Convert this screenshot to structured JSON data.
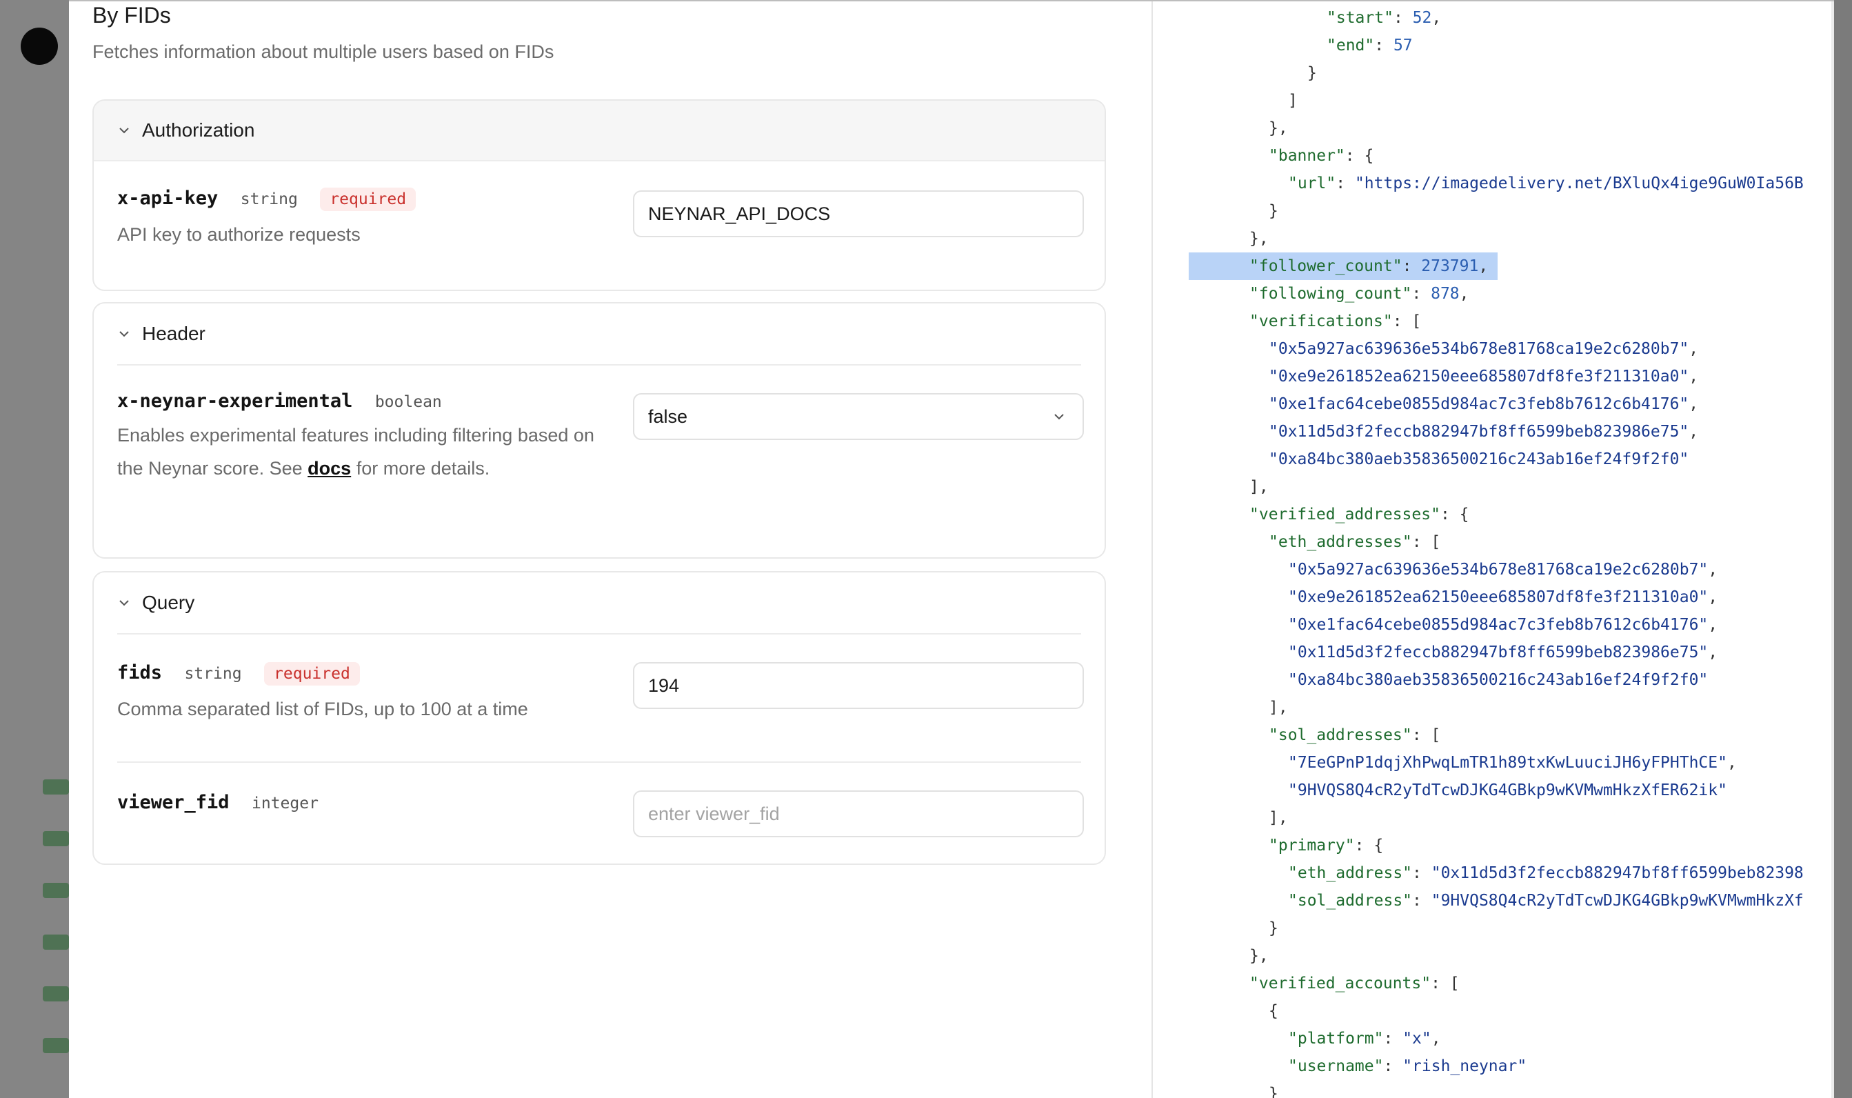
{
  "modal": {
    "title": "By FIDs",
    "description": "Fetches information about multiple users based on FIDs"
  },
  "authorization": {
    "section_title": "Authorization",
    "param": {
      "name": "x-api-key",
      "type": "string",
      "required_label": "required",
      "description": "API key to authorize requests",
      "value": "NEYNAR_API_DOCS"
    }
  },
  "header": {
    "section_title": "Header",
    "param": {
      "name": "x-neynar-experimental",
      "type": "boolean",
      "description_before": "Enables experimental features including filtering based on the Neynar score. See ",
      "link_text": "docs",
      "description_after": " for more details.",
      "value": "false"
    }
  },
  "query": {
    "section_title": "Query",
    "fids": {
      "name": "fids",
      "type": "string",
      "required_label": "required",
      "description": "Comma separated list of FIDs, up to 100 at a time",
      "value": "194"
    },
    "viewer_fid": {
      "name": "viewer_fid",
      "type": "integer",
      "placeholder": "enter viewer_fid"
    }
  },
  "colors": {
    "json_key": "#1e6b2e",
    "json_string": "#1a3a8f",
    "json_number": "#2a5db0",
    "highlight": "#b9d3f7",
    "required_badge": "#c9302c"
  },
  "response_json_lines": [
    {
      "indent": 8,
      "parts": [
        [
          "k",
          "\"start\""
        ],
        [
          "p",
          ": "
        ],
        [
          "n",
          "52"
        ],
        [
          "p",
          ","
        ]
      ]
    },
    {
      "indent": 8,
      "parts": [
        [
          "k",
          "\"end\""
        ],
        [
          "p",
          ": "
        ],
        [
          "n",
          "57"
        ]
      ]
    },
    {
      "indent": 7,
      "parts": [
        [
          "p",
          "}"
        ]
      ]
    },
    {
      "indent": 6,
      "parts": [
        [
          "p",
          "]"
        ]
      ]
    },
    {
      "indent": 5,
      "parts": [
        [
          "p",
          "},"
        ]
      ]
    },
    {
      "indent": 5,
      "parts": [
        [
          "k",
          "\"banner\""
        ],
        [
          "p",
          ": {"
        ]
      ]
    },
    {
      "indent": 6,
      "parts": [
        [
          "k",
          "\"url\""
        ],
        [
          "p",
          ": "
        ],
        [
          "s",
          "\"https://imagedelivery.net/BXluQx4ige9GuW0Ia56B"
        ]
      ]
    },
    {
      "indent": 5,
      "parts": [
        [
          "p",
          "}"
        ]
      ]
    },
    {
      "indent": 4,
      "parts": [
        [
          "p",
          "},"
        ]
      ]
    },
    {
      "indent": 4,
      "highlight": true,
      "parts": [
        [
          "k",
          "\"follower_count\""
        ],
        [
          "p",
          ": "
        ],
        [
          "n",
          "273791"
        ],
        [
          "p",
          ","
        ]
      ]
    },
    {
      "indent": 4,
      "parts": [
        [
          "k",
          "\"following_count\""
        ],
        [
          "p",
          ": "
        ],
        [
          "n",
          "878"
        ],
        [
          "p",
          ","
        ]
      ]
    },
    {
      "indent": 4,
      "parts": [
        [
          "k",
          "\"verifications\""
        ],
        [
          "p",
          ": ["
        ]
      ]
    },
    {
      "indent": 5,
      "parts": [
        [
          "s",
          "\"0x5a927ac639636e534b678e81768ca19e2c6280b7\""
        ],
        [
          "p",
          ","
        ]
      ]
    },
    {
      "indent": 5,
      "parts": [
        [
          "s",
          "\"0xe9e261852ea62150eee685807df8fe3f211310a0\""
        ],
        [
          "p",
          ","
        ]
      ]
    },
    {
      "indent": 5,
      "parts": [
        [
          "s",
          "\"0xe1fac64cebe0855d984ac7c3feb8b7612c6b4176\""
        ],
        [
          "p",
          ","
        ]
      ]
    },
    {
      "indent": 5,
      "parts": [
        [
          "s",
          "\"0x11d5d3f2feccb882947bf8ff6599beb823986e75\""
        ],
        [
          "p",
          ","
        ]
      ]
    },
    {
      "indent": 5,
      "parts": [
        [
          "s",
          "\"0xa84bc380aeb35836500216c243ab16ef24f9f2f0\""
        ]
      ]
    },
    {
      "indent": 4,
      "parts": [
        [
          "p",
          "],"
        ]
      ]
    },
    {
      "indent": 4,
      "parts": [
        [
          "k",
          "\"verified_addresses\""
        ],
        [
          "p",
          ": {"
        ]
      ]
    },
    {
      "indent": 5,
      "parts": [
        [
          "k",
          "\"eth_addresses\""
        ],
        [
          "p",
          ": ["
        ]
      ]
    },
    {
      "indent": 6,
      "parts": [
        [
          "s",
          "\"0x5a927ac639636e534b678e81768ca19e2c6280b7\""
        ],
        [
          "p",
          ","
        ]
      ]
    },
    {
      "indent": 6,
      "parts": [
        [
          "s",
          "\"0xe9e261852ea62150eee685807df8fe3f211310a0\""
        ],
        [
          "p",
          ","
        ]
      ]
    },
    {
      "indent": 6,
      "parts": [
        [
          "s",
          "\"0xe1fac64cebe0855d984ac7c3feb8b7612c6b4176\""
        ],
        [
          "p",
          ","
        ]
      ]
    },
    {
      "indent": 6,
      "parts": [
        [
          "s",
          "\"0x11d5d3f2feccb882947bf8ff6599beb823986e75\""
        ],
        [
          "p",
          ","
        ]
      ]
    },
    {
      "indent": 6,
      "parts": [
        [
          "s",
          "\"0xa84bc380aeb35836500216c243ab16ef24f9f2f0\""
        ]
      ]
    },
    {
      "indent": 5,
      "parts": [
        [
          "p",
          "],"
        ]
      ]
    },
    {
      "indent": 5,
      "parts": [
        [
          "k",
          "\"sol_addresses\""
        ],
        [
          "p",
          ": ["
        ]
      ]
    },
    {
      "indent": 6,
      "parts": [
        [
          "s",
          "\"7EeGPnP1dqjXhPwqLmTR1h89txKwLuuciJH6yFPHThCE\""
        ],
        [
          "p",
          ","
        ]
      ]
    },
    {
      "indent": 6,
      "parts": [
        [
          "s",
          "\"9HVQS8Q4cR2yTdTcwDJKG4GBkp9wKVMwmHkzXfER62ik\""
        ]
      ]
    },
    {
      "indent": 5,
      "parts": [
        [
          "p",
          "],"
        ]
      ]
    },
    {
      "indent": 5,
      "parts": [
        [
          "k",
          "\"primary\""
        ],
        [
          "p",
          ": {"
        ]
      ]
    },
    {
      "indent": 6,
      "parts": [
        [
          "k",
          "\"eth_address\""
        ],
        [
          "p",
          ": "
        ],
        [
          "s",
          "\"0x11d5d3f2feccb882947bf8ff6599beb82398"
        ]
      ]
    },
    {
      "indent": 6,
      "parts": [
        [
          "k",
          "\"sol_address\""
        ],
        [
          "p",
          ": "
        ],
        [
          "s",
          "\"9HVQS8Q4cR2yTdTcwDJKG4GBkp9wKVMwmHkzXf"
        ]
      ]
    },
    {
      "indent": 5,
      "parts": [
        [
          "p",
          "}"
        ]
      ]
    },
    {
      "indent": 4,
      "parts": [
        [
          "p",
          "},"
        ]
      ]
    },
    {
      "indent": 4,
      "parts": [
        [
          "k",
          "\"verified_accounts\""
        ],
        [
          "p",
          ": ["
        ]
      ]
    },
    {
      "indent": 5,
      "parts": [
        [
          "p",
          "{"
        ]
      ]
    },
    {
      "indent": 6,
      "parts": [
        [
          "k",
          "\"platform\""
        ],
        [
          "p",
          ": "
        ],
        [
          "s",
          "\"x\""
        ],
        [
          "p",
          ","
        ]
      ]
    },
    {
      "indent": 6,
      "parts": [
        [
          "k",
          "\"username\""
        ],
        [
          "p",
          ": "
        ],
        [
          "s",
          "\"rish_neynar\""
        ]
      ]
    },
    {
      "indent": 5,
      "parts": [
        [
          "p",
          "}"
        ]
      ]
    }
  ]
}
